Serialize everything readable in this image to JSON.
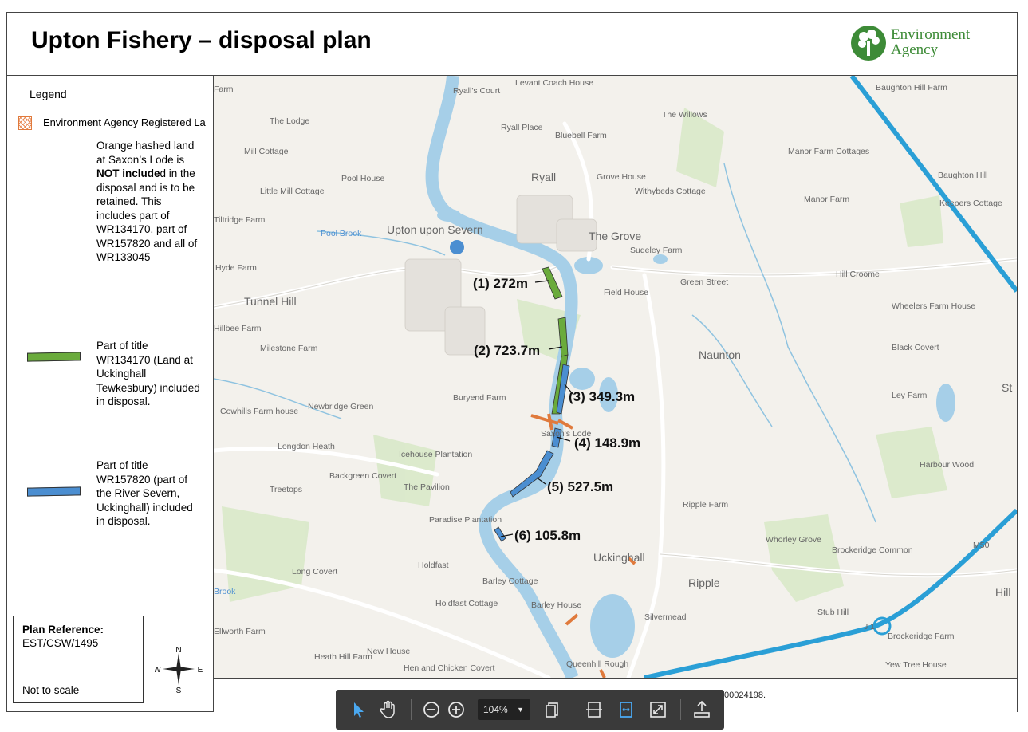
{
  "header": {
    "title": "Upton Fishery – disposal plan",
    "logo_line1": "Environment",
    "logo_line2": "Agency"
  },
  "legend": {
    "title": "Legend",
    "row1_label": "Environment Agency Registered La",
    "orange_note_1": "Orange hashed land at Saxon’s Lode is ",
    "orange_note_bold1": "NOT",
    "orange_note_bold2": "include",
    "orange_note_2": "d in the disposal and is to be retained. This includes part of WR134170, part of WR157820 and all of WR133045",
    "green_text": "Part of title WR134170 (Land at Uckinghall Tewkesbury) included in disposal.",
    "blue_text": "Part of title WR157820 (part of the River Severn, Uckinghall) included in disposal."
  },
  "plan_ref": {
    "label": "Plan Reference:",
    "value": "EST/CSW/1495",
    "scale": "Not to scale"
  },
  "compass": {
    "n": "N",
    "s": "S",
    "e": "E",
    "w": "W"
  },
  "segments": [
    {
      "label": "(1) 272m"
    },
    {
      "label": "(2) 723.7m"
    },
    {
      "label": "(3) 349.3m"
    },
    {
      "label": "(4) 148.9m"
    },
    {
      "label": "(5) 527.5m"
    },
    {
      "label": "(6) 105.8m"
    }
  ],
  "places": [
    "Farm",
    "The Lodge",
    "Mill Cottage",
    "Little Mill Cottage",
    "Pool House",
    "Tiltridge Farm",
    "Hyde Farm",
    "Tunnel Hill",
    "Hillbee Farm",
    "Milestone Farm",
    "Cowhills Farm house",
    "Newbridge Green",
    "Longdon Heath",
    "Backgreen Covert",
    "Treetops",
    "Long Covert",
    "Heath Hill Farm",
    "Ellworth Farm",
    "Ryall's Court",
    "Levant Coach House",
    "Ryall Place",
    "Bluebell Farm",
    "Ryall",
    "Upton upon Severn",
    "Pool Brook",
    "Grove House",
    "Withybeds Cottage",
    "The Grove",
    "Sudeley Farm",
    "Field House",
    "Green Street",
    "The Willows",
    "Manor Farm Cottages",
    "Manor Farm",
    "Baughton Hill Farm",
    "Baughton Hill",
    "Keepers Cottage",
    "Hill Croome",
    "Wheelers Farm House",
    "Black Covert",
    "Naunton",
    "Ley Farm",
    "Buryend Farm",
    "Saxon's Lode",
    "Icehouse Plantation",
    "The Pavilion",
    "Paradise Plantation",
    "Holdfast",
    "Barley Cottage",
    "Holdfast Cottage",
    "Barley House",
    "New House",
    "Hen and Chicken Covert",
    "Queenhill Rough",
    "Uckinghall",
    "Ripple",
    "Ripple Farm",
    "Whorley Grove",
    "Brockeridge Common",
    "Harbour Wood",
    "Silvermead",
    "Stub Hill",
    "Brockeridge Farm",
    "Yew Tree House",
    "Hill",
    "St",
    "M50",
    "J 1",
    "Brook"
  ],
  "footer": {
    "copyright": "00024198."
  },
  "toolbar": {
    "zoom": "104%"
  },
  "colors": {
    "green": "#6aab3c",
    "blue": "#4b8ed1",
    "orange": "#e07a3c",
    "river": "#a6cfe8",
    "motorway": "#2a9fd6"
  }
}
